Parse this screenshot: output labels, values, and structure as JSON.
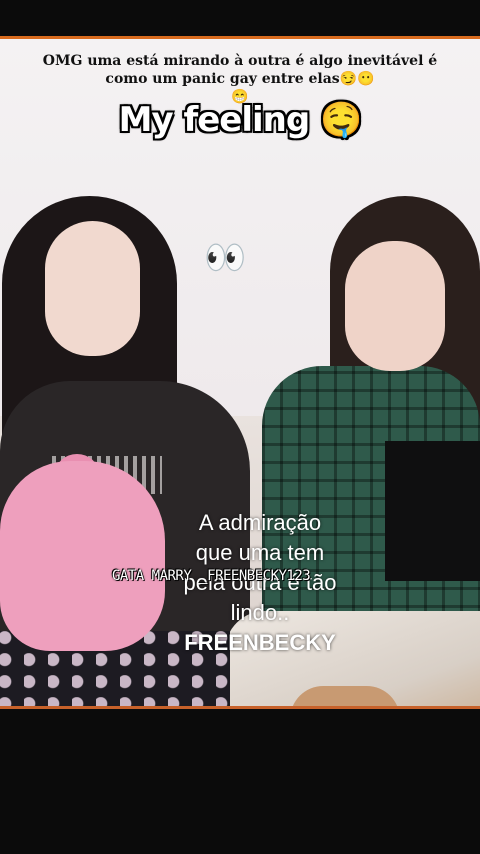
{
  "overlay": {
    "caption_top": "OMG uma está mirando à outra é algo inevitável é como um panic gay  entre elas😏😶",
    "caption_top_extra": "😁",
    "title": "My feeling 🤤",
    "eyes": "👀",
    "watermark": "GATA MARRY _FREENBECKY123",
    "subtitle": {
      "line1": "A admiração",
      "line2": "que uma tem",
      "line3": "pela outra é tão",
      "line4": "lindo..",
      "line5": "FREENBECKY"
    }
  },
  "colors": {
    "accent_border": "#d96b1e",
    "background": "#0b0b0b"
  }
}
